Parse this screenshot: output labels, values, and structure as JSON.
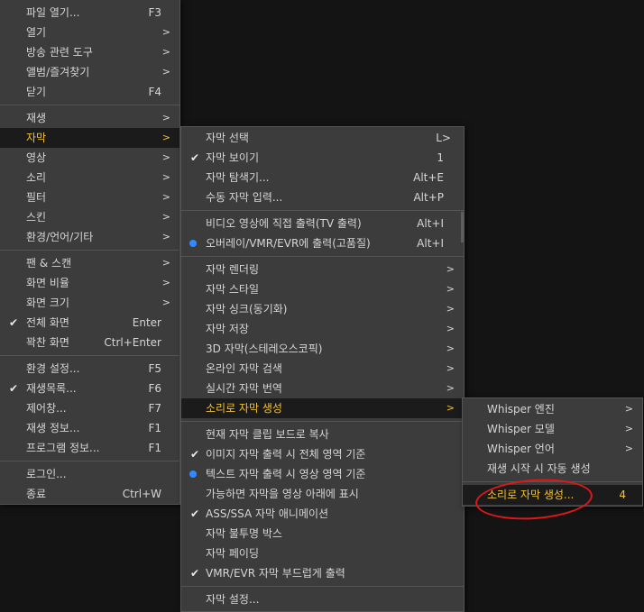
{
  "main_menu": {
    "items": [
      {
        "label": "파일 열기...",
        "shortcut": "F3"
      },
      {
        "label": "열기",
        "arrow": ">"
      },
      {
        "label": "방송 관련 도구",
        "arrow": ">"
      },
      {
        "label": "앨범/즐겨찾기",
        "arrow": ">"
      },
      {
        "label": "닫기",
        "shortcut": "F4"
      },
      {
        "label": "재생",
        "arrow": ">"
      },
      {
        "label": "자막",
        "arrow": ">"
      },
      {
        "label": "영상",
        "arrow": ">"
      },
      {
        "label": "소리",
        "arrow": ">"
      },
      {
        "label": "필터",
        "arrow": ">"
      },
      {
        "label": "스킨",
        "arrow": ">"
      },
      {
        "label": "환경/언어/기타",
        "arrow": ">"
      },
      {
        "label": "팬 & 스캔",
        "arrow": ">"
      },
      {
        "label": "화면 비율",
        "arrow": ">"
      },
      {
        "label": "화면 크기",
        "arrow": ">"
      },
      {
        "label": "전체 화면",
        "shortcut": "Enter",
        "mark": "✔"
      },
      {
        "label": "꽉찬 화면",
        "shortcut": "Ctrl+Enter"
      },
      {
        "label": "환경 설정...",
        "shortcut": "F5"
      },
      {
        "label": "재생목록...",
        "shortcut": "F6",
        "mark": "✔"
      },
      {
        "label": "제어창...",
        "shortcut": "F7"
      },
      {
        "label": "재생 정보...",
        "shortcut": "F1"
      },
      {
        "label": "프로그램 정보...",
        "shortcut": "F1"
      },
      {
        "label": "로그인..."
      },
      {
        "label": "종료",
        "shortcut": "Ctrl+W"
      }
    ]
  },
  "subtitle_menu": {
    "items": [
      {
        "label": "자막 선택",
        "shortcut": "L>"
      },
      {
        "label": "자막 보이기",
        "shortcut": "1",
        "mark": "✔"
      },
      {
        "label": "자막 탐색기...",
        "shortcut": "Alt+E"
      },
      {
        "label": "수동 자막 입력...",
        "shortcut": "Alt+P"
      },
      {
        "label": "비디오 영상에 직접 출력(TV 출력)",
        "shortcut": "Alt+I"
      },
      {
        "label": "오버레이/VMR/EVR에 출력(고품질)",
        "shortcut": "Alt+I"
      },
      {
        "label": "자막 렌더링",
        "arrow": ">"
      },
      {
        "label": "자막 스타일",
        "arrow": ">"
      },
      {
        "label": "자막 싱크(동기화)",
        "arrow": ">"
      },
      {
        "label": "자막 저장",
        "arrow": ">"
      },
      {
        "label": "3D 자막(스테레오스코픽)",
        "arrow": ">"
      },
      {
        "label": "온라인 자막 검색",
        "arrow": ">"
      },
      {
        "label": "실시간 자막 번역",
        "arrow": ">"
      },
      {
        "label": "소리로 자막 생성",
        "arrow": ">"
      },
      {
        "label": "현재 자막 클립 보드로 복사"
      },
      {
        "label": "이미지 자막 출력 시 전체 영역 기준",
        "mark": "✔"
      },
      {
        "label": "텍스트 자막 출력 시 영상 영역 기준"
      },
      {
        "label": "가능하면 자막을 영상 아래에 표시"
      },
      {
        "label": "ASS/SSA 자막 애니메이션",
        "mark": "✔"
      },
      {
        "label": "자막 불투명 박스"
      },
      {
        "label": "자막 페이딩"
      },
      {
        "label": "VMR/EVR 자막 부드럽게 출력",
        "mark": "✔"
      },
      {
        "label": "자막 설정..."
      }
    ]
  },
  "generate_menu": {
    "items": [
      {
        "label": "Whisper 엔진",
        "arrow": ">"
      },
      {
        "label": "Whisper 모델",
        "arrow": ">"
      },
      {
        "label": "Whisper 언어",
        "arrow": ">"
      },
      {
        "label": "재생 시작 시 자동 생성"
      },
      {
        "label": "소리로 자막 생성...",
        "shortcut": "4"
      }
    ]
  },
  "colors": {
    "highlight_text": "#f2c230",
    "radio_dot": "#2f8bff",
    "annotation_circle": "#e01818"
  },
  "icons": {
    "check": "check-icon",
    "radio": "radio-dot-icon",
    "arrow": "chevron-right-icon"
  }
}
